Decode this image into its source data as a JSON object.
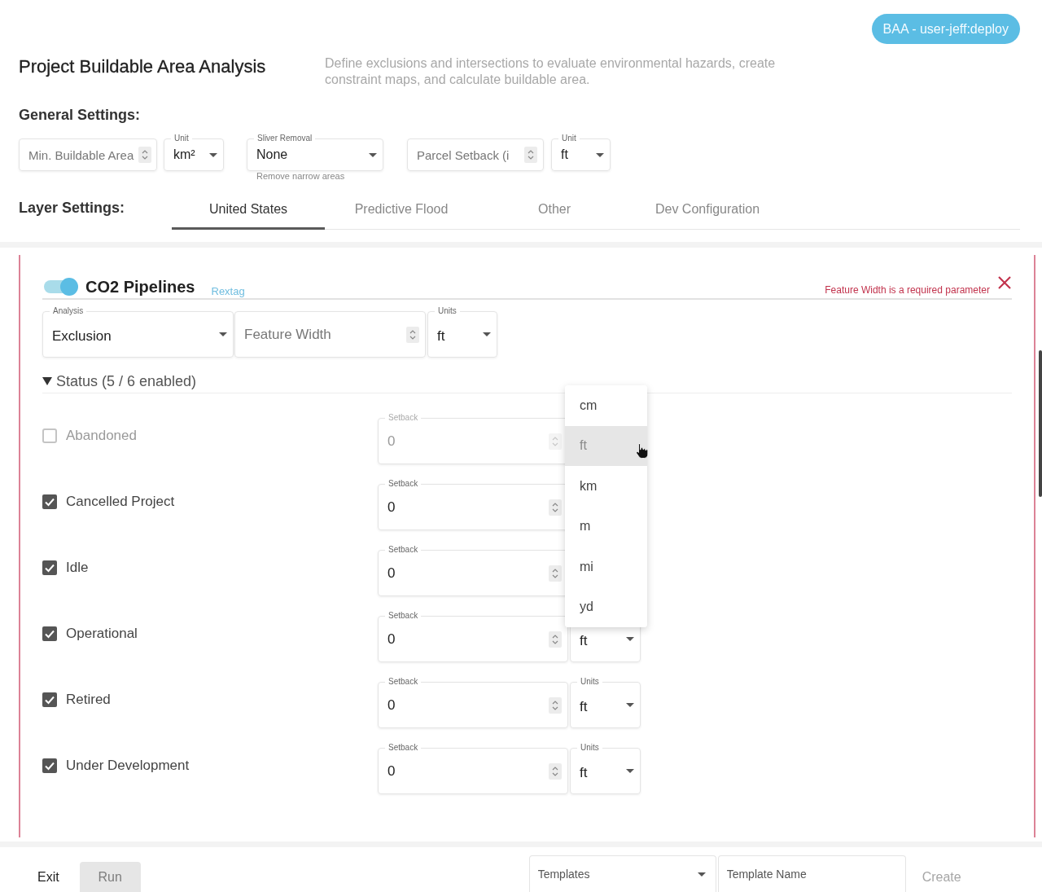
{
  "badge": {
    "label": "BAA - user-jeff:deploy"
  },
  "header": {
    "title": "Project Buildable Area Analysis",
    "description": "Define exclusions and intersections to evaluate environmental hazards, create constraint maps, and calculate buildable area."
  },
  "general_settings": {
    "heading": "General Settings:",
    "fields": [
      {
        "kind": "number",
        "placeholder": "Min. Buildable Area"
      },
      {
        "kind": "select",
        "label": "Unit",
        "value": "km²"
      },
      {
        "kind": "select",
        "label": "Sliver Removal",
        "value": "None",
        "helper": "Remove narrow areas"
      },
      {
        "kind": "number",
        "placeholder": "Parcel Setback (i"
      },
      {
        "kind": "select",
        "label": "Unit",
        "value": "ft"
      }
    ]
  },
  "layer_settings": {
    "heading": "Layer Settings:",
    "tabs": [
      {
        "label": "United States",
        "selected": true
      },
      {
        "label": "Predictive Flood",
        "selected": false
      },
      {
        "label": "Other",
        "selected": false
      },
      {
        "label": "Dev Configuration",
        "selected": false
      }
    ]
  },
  "layer": {
    "enabled": true,
    "name": "CO2 Pipelines",
    "source": "Rextag",
    "error": "Feature Width is a required parameter",
    "analysis": {
      "label": "Analysis",
      "value": "Exclusion"
    },
    "feature_width": {
      "placeholder": "Feature Width"
    },
    "units": {
      "label": "Units",
      "value": "ft"
    },
    "status": {
      "title": "Status (5 / 6 enabled)",
      "expanded": true
    },
    "rows": [
      {
        "label": "Abandoned",
        "checked": false,
        "disabled": true,
        "setback": {
          "label": "Setback",
          "value": "0"
        }
      },
      {
        "label": "Cancelled Project",
        "checked": true,
        "disabled": false,
        "setback": {
          "label": "Setback",
          "value": "0"
        }
      },
      {
        "label": "Idle",
        "checked": true,
        "disabled": false,
        "setback": {
          "label": "Setback",
          "value": "0"
        }
      },
      {
        "label": "Operational",
        "checked": true,
        "disabled": false,
        "setback": {
          "label": "Setback",
          "value": "0"
        },
        "units": {
          "value": "ft"
        }
      },
      {
        "label": "Retired",
        "checked": true,
        "disabled": false,
        "setback": {
          "label": "Setback",
          "value": "0"
        },
        "units": {
          "label": "Units",
          "value": "ft"
        }
      },
      {
        "label": "Under Development",
        "checked": true,
        "disabled": false,
        "setback": {
          "label": "Setback",
          "value": "0"
        },
        "units": {
          "label": "Units",
          "value": "ft"
        }
      }
    ]
  },
  "units_menu": {
    "items": [
      {
        "label": "cm",
        "selected": false
      },
      {
        "label": "ft",
        "selected": true
      },
      {
        "label": "km",
        "selected": false
      },
      {
        "label": "m",
        "selected": false
      },
      {
        "label": "mi",
        "selected": false
      },
      {
        "label": "yd",
        "selected": false
      }
    ]
  },
  "footer": {
    "exit": "Exit",
    "run": {
      "label": "Run",
      "disabled": true
    },
    "templates": {
      "label": "Templates"
    },
    "template_name": {
      "placeholder": "Template Name"
    },
    "create": {
      "label": "Create",
      "disabled": true
    }
  }
}
